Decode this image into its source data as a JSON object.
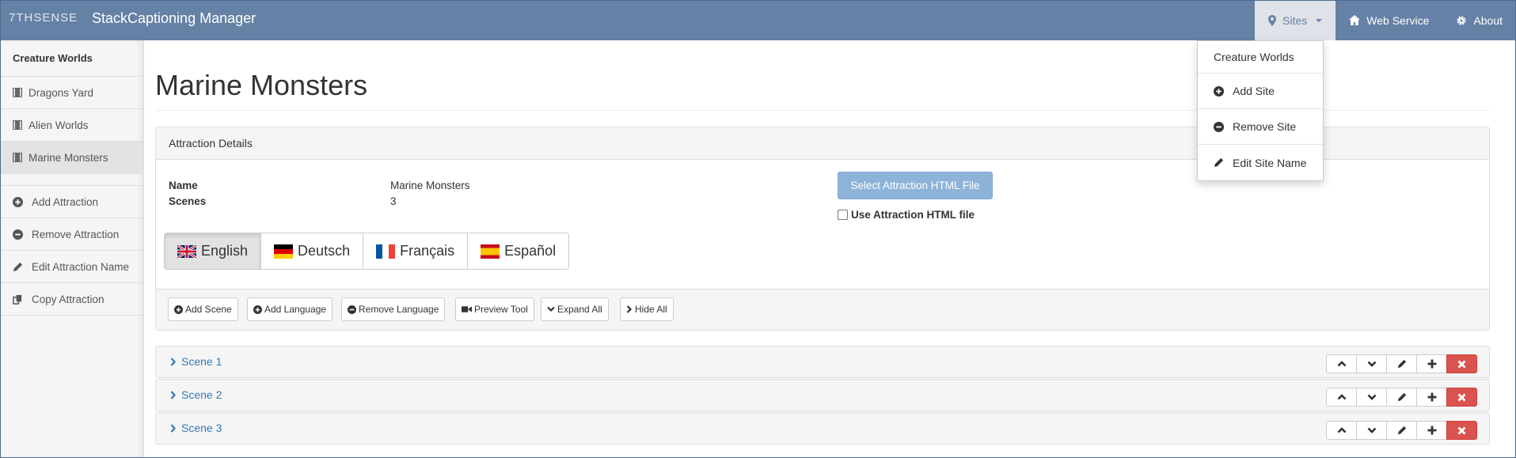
{
  "navbar": {
    "logo": "7THSENSE",
    "title": "StackCaptioning Manager",
    "sites_label": "Sites",
    "web_service_label": "Web Service",
    "about_label": "About"
  },
  "sites_menu": {
    "header": "Creature Worlds",
    "items": [
      {
        "label": "Add Site",
        "icon": "plus-circle-icon"
      },
      {
        "label": "Remove Site",
        "icon": "minus-circle-icon"
      },
      {
        "label": "Edit Site Name",
        "icon": "pencil-icon"
      }
    ]
  },
  "sidebar": {
    "site_name": "Creature Worlds",
    "attractions": [
      {
        "label": "Dragons Yard",
        "icon": "film-icon",
        "active": false
      },
      {
        "label": "Alien Worlds",
        "icon": "film-icon",
        "active": false
      },
      {
        "label": "Marine Monsters",
        "icon": "film-icon",
        "active": true
      }
    ],
    "actions": [
      {
        "label": "Add Attraction",
        "icon": "plus-circle-icon"
      },
      {
        "label": "Remove Attraction",
        "icon": "minus-circle-icon"
      },
      {
        "label": "Edit Attraction Name",
        "icon": "pencil-icon"
      },
      {
        "label": "Copy Attraction",
        "icon": "copy-icon"
      }
    ]
  },
  "main": {
    "page_title": "Marine Monsters",
    "panel_heading": "Attraction Details",
    "details": {
      "name_label": "Name",
      "name_value": "Marine Monsters",
      "scenes_label": "Scenes",
      "scenes_value": "3"
    },
    "select_file_button": "Select Attraction HTML File",
    "use_file_label": "Use Attraction HTML file",
    "use_file_checked": false,
    "languages": [
      {
        "label": "English",
        "flag": "uk-flag-icon",
        "active": true
      },
      {
        "label": "Deutsch",
        "flag": "germany-flag-icon",
        "active": false
      },
      {
        "label": "Français",
        "flag": "france-flag-icon",
        "active": false
      },
      {
        "label": "Español",
        "flag": "spain-flag-icon",
        "active": false
      }
    ],
    "toolbar": {
      "add_scene": "Add Scene",
      "add_language": "Add Language",
      "remove_language": "Remove Language",
      "preview_tool": "Preview Tool",
      "expand_all": "Expand All",
      "hide_all": "Hide All"
    },
    "scenes": [
      {
        "label": "Scene 1"
      },
      {
        "label": "Scene 2"
      },
      {
        "label": "Scene 3"
      }
    ]
  },
  "colors": {
    "navbar": "#6681a6",
    "link": "#337ab7",
    "primary_light": "#8db3d9",
    "danger": "#d9534f"
  }
}
